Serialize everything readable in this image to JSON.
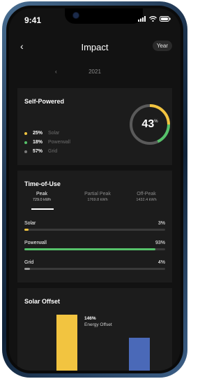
{
  "status": {
    "time": "9:41"
  },
  "header": {
    "title": "Impact",
    "back": "‹",
    "period_pill": "Year"
  },
  "year_nav": {
    "prev": "‹",
    "year": "2021"
  },
  "self_powered": {
    "title": "Self-Powered",
    "percent": "43",
    "percent_unit": "%",
    "items": [
      {
        "pct": "25%",
        "name": "Solar",
        "color": "#f2c440"
      },
      {
        "pct": "18%",
        "name": "Powerwall",
        "color": "#56c26a"
      },
      {
        "pct": "57%",
        "name": "Grid",
        "color": "#7a7a7a"
      }
    ],
    "donut_fractions": {
      "solar": 0.25,
      "powerwall": 0.18,
      "grid": 0.57
    }
  },
  "time_of_use": {
    "title": "Time-of-Use",
    "tabs": [
      {
        "label": "Peak",
        "value": "729.0 kWh",
        "active": true
      },
      {
        "label": "Partial Peak",
        "value": "1769.8 kWh",
        "active": false
      },
      {
        "label": "Off-Peak",
        "value": "1432.4 kWh",
        "active": false
      }
    ],
    "bars": [
      {
        "label": "Solar",
        "pct": "3%",
        "fraction": 0.03,
        "color": "#f2c440"
      },
      {
        "label": "Powerwall",
        "pct": "93%",
        "fraction": 0.93,
        "color": "#56c26a"
      },
      {
        "label": "Grid",
        "pct": "4%",
        "fraction": 0.04,
        "color": "#9a9a9a"
      }
    ]
  },
  "solar_offset": {
    "title": "Solar Offset",
    "pct": "146%",
    "label": "Energy Offset",
    "bars": [
      {
        "name": "solar",
        "color": "#f2c440",
        "relative_height": 1.0
      },
      {
        "name": "usage",
        "color": "#4a69b8",
        "relative_height": 0.68
      }
    ]
  },
  "colors": {
    "background": "#121212",
    "card": "#1c1c1c",
    "track": "#3a3a3a"
  }
}
